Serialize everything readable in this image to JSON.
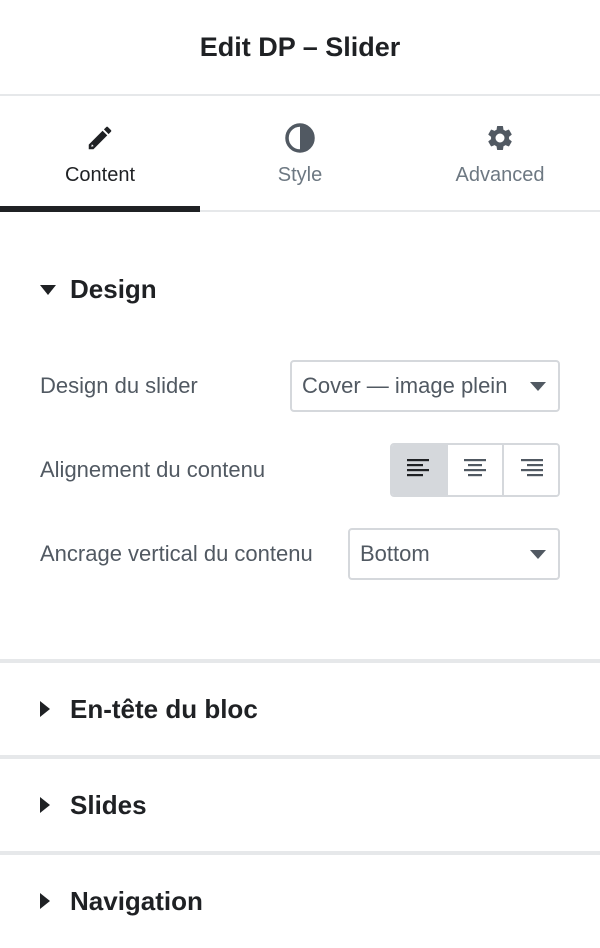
{
  "header": {
    "title": "Edit DP – Slider"
  },
  "tabs": [
    {
      "label": "Content",
      "icon": "pencil-icon",
      "active": true
    },
    {
      "label": "Style",
      "icon": "half-circle-icon",
      "active": false
    },
    {
      "label": "Advanced",
      "icon": "gear-icon",
      "active": false
    }
  ],
  "design_section": {
    "title": "Design",
    "slider_design": {
      "label": "Design du slider",
      "value": "Cover — image plein"
    },
    "content_alignment": {
      "label": "Alignement du contenu",
      "options": [
        "align-left-icon",
        "align-center-icon",
        "align-right-icon"
      ],
      "selected": "left"
    },
    "vertical_anchor": {
      "label": "Ancrage vertical du contenu",
      "value": "Bottom"
    }
  },
  "collapsed_sections": [
    {
      "title": "En-tête du bloc"
    },
    {
      "title": "Slides"
    },
    {
      "title": "Navigation"
    }
  ],
  "colors": {
    "text_dark": "#1f2124",
    "text_muted": "#515962",
    "border": "#d5d8dc",
    "active_tab_bar": "#1f2124"
  }
}
